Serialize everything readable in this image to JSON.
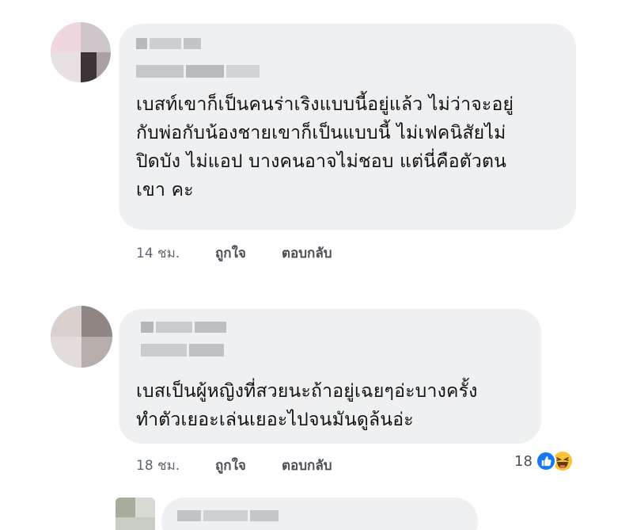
{
  "comments": [
    {
      "text_lines": [
        "เบสท์เขาก็เป็นคนร่าเริงแบบนี้อยู่แล้ว ไม่ว่าจะอยู่",
        "กับพ่อกับน้องชายเขาก็เป็นแบบนี้ ไม่เฟคนิสัยไม่",
        "ปิดบัง ไม่แอป บางคนอาจไม่ชอบ แต่นี่คือตัวตน",
        "เขา คะ"
      ],
      "time": "14 ชม.",
      "like_label": "ถูกใจ",
      "reply_label": "ตอบกลับ"
    },
    {
      "text_lines": [
        "เบสเป็นผู้หญิงที่สวยนะถ้าอยู่เฉยๆอ่ะบางครั้ง",
        "ทำตัวเยอะเล่นเยอะไปจนมันดูล้นอ่ะ"
      ],
      "time": "18 ชม.",
      "like_label": "ถูกใจ",
      "reply_label": "ตอบกลับ",
      "reaction_count": "18",
      "reaction_icons": [
        "like-icon",
        "haha-icon"
      ]
    }
  ],
  "colors": {
    "bubble": "#eff0f2",
    "like_blue": "#1877f2",
    "haha_yellow": "#f7c536"
  }
}
